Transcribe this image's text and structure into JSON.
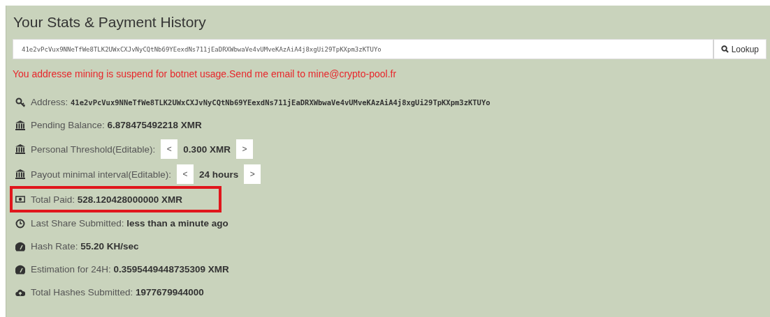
{
  "panel": {
    "title": "Your Stats & Payment History"
  },
  "lookup": {
    "value": "41e2vPcVux9NNeTfWe8TLK2UWxCXJvNyCQtNb69YEexdNs711jEaDRXWbwaVe4vUMveKAzAiA4j8xgUi29TpKXpm3zKTUYo",
    "button": "Lookup"
  },
  "alert": "You addresse mining is suspend for botnet usage.Send me email to mine@crypto-pool.fr",
  "stats": [
    {
      "kind": "address",
      "label": "Address:",
      "value": "41e2vPcVux9NNeTfWe8TLK2UWxCXJvNyCQtNb69YEexdNs711jEaDRXWbwaVe4vUMveKAzAiA4j8xgUi29TpKXpm3zKTUYo",
      "highlighted": false
    },
    {
      "kind": "text",
      "label": "Pending Balance:",
      "value": "6.878475492218 XMR",
      "highlighted": false
    },
    {
      "kind": "stepper",
      "label": "Personal Threshold(Editable):",
      "value": "0.300 XMR",
      "decrease": "<",
      "increase": ">",
      "highlighted": false
    },
    {
      "kind": "stepper",
      "label": "Payout minimal interval(Editable):",
      "value": "24 hours",
      "decrease": "<",
      "increase": ">",
      "highlighted": false
    },
    {
      "kind": "text",
      "label": "Total Paid:",
      "value": "528.120428000000 XMR",
      "highlighted": true
    },
    {
      "kind": "text",
      "label": "Last Share Submitted:",
      "value": "less than a minute ago",
      "highlighted": false
    },
    {
      "kind": "text",
      "label": "Hash Rate:",
      "value": "55.20 KH/sec",
      "highlighted": false
    },
    {
      "kind": "text",
      "label": "Estimation for 24H:",
      "value": "0.3595449448735309 XMR",
      "highlighted": false
    },
    {
      "kind": "text",
      "label": "Total Hashes Submitted:",
      "value": "1977679944000",
      "highlighted": false
    }
  ]
}
